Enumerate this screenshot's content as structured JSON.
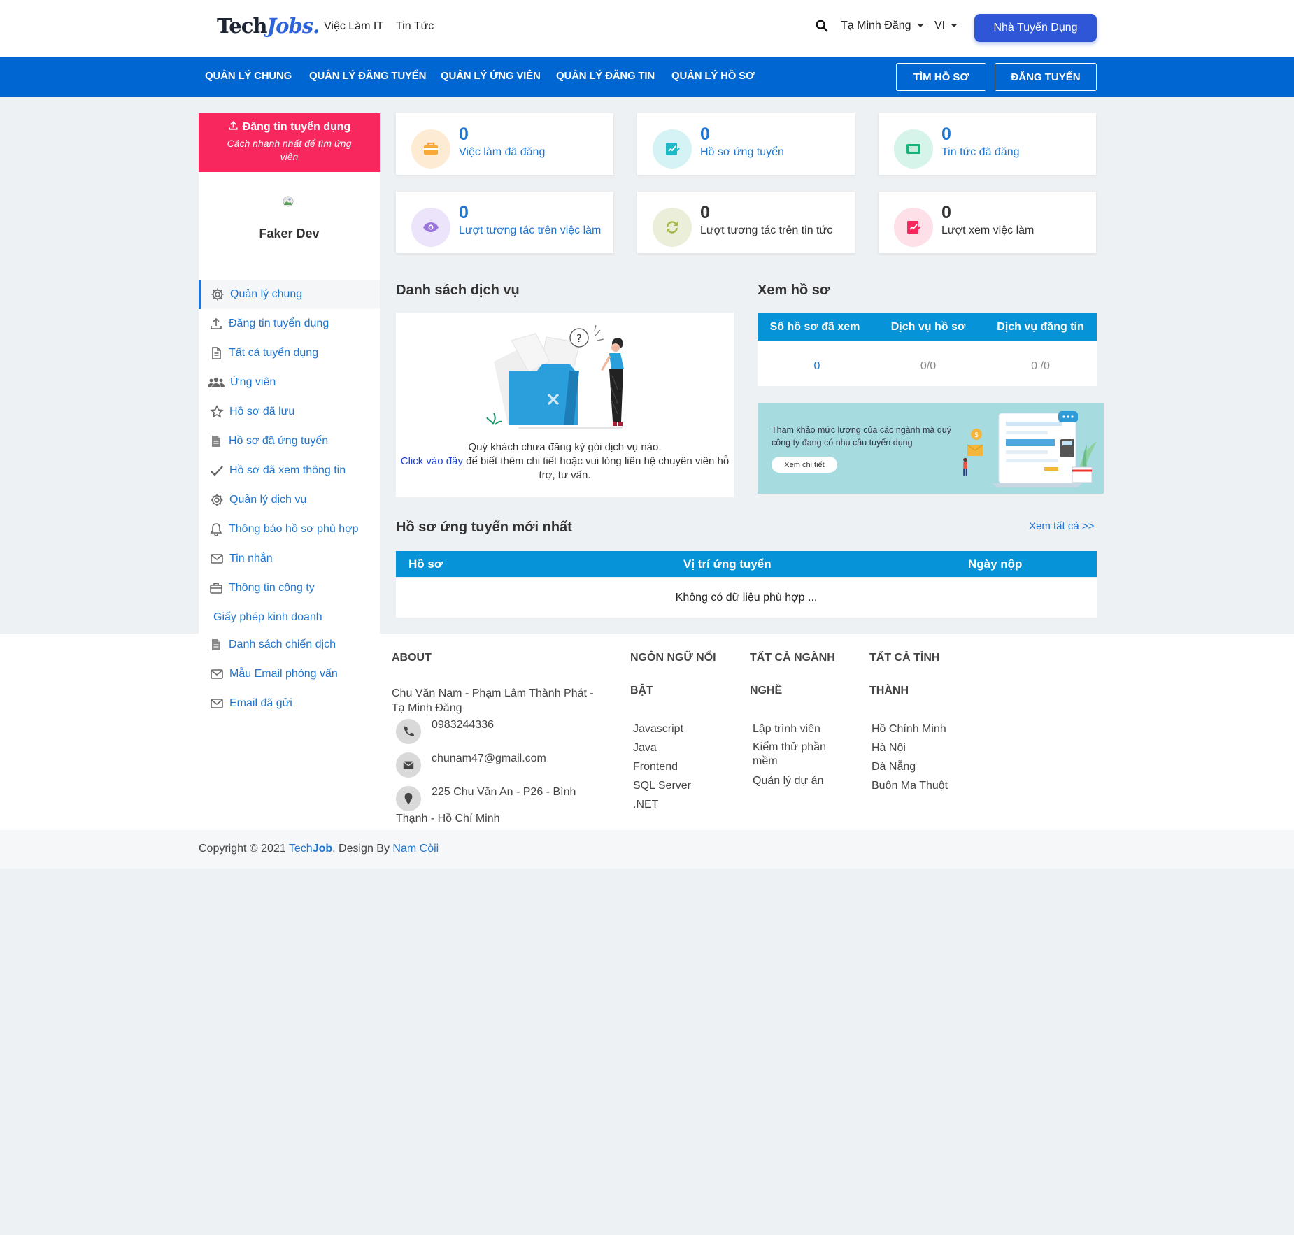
{
  "header": {
    "logo_part1": "Tech",
    "logo_part2": "Jobs.",
    "nav": [
      "Việc Làm IT",
      "Tin Tức"
    ],
    "user": "Tạ Minh Đăng",
    "lang": "VI",
    "employer_button": "Nhà Tuyển Dụng"
  },
  "main_nav": {
    "items": [
      "QUẢN LÝ CHUNG",
      "QUẢN LÝ ĐĂNG TUYỂN",
      "QUẢN LÝ ỨNG VIÊN",
      "QUẢN LÝ ĐĂNG TIN",
      "QUẢN LÝ HỒ SƠ"
    ],
    "btn_find": "TÌM HỒ SƠ",
    "btn_post": "ĐĂNG TUYỂN"
  },
  "sidebar": {
    "post_title": "Đăng tin tuyển dụng",
    "post_subtitle": "Cách nhanh nhất để tìm ứng viên",
    "profile_name": "Faker Dev",
    "menu": [
      {
        "label": "Quản lý chung",
        "icon": "gear-icon"
      },
      {
        "label": "Đăng tin tuyển dụng",
        "icon": "upload-icon"
      },
      {
        "label": "Tất cả tuyển dụng",
        "icon": "document-icon"
      },
      {
        "label": "Ứng viên",
        "icon": "users-icon"
      },
      {
        "label": "Hồ sơ đã lưu",
        "icon": "star-icon"
      },
      {
        "label": "Hồ sơ đã ứng tuyển",
        "icon": "file-icon"
      },
      {
        "label": "Hồ sơ đã xem thông tin",
        "icon": "check-icon"
      },
      {
        "label": "Quản lý dịch vụ",
        "icon": "gear-icon"
      },
      {
        "label": "Thông báo hồ sơ phù hợp",
        "icon": "bell-icon"
      },
      {
        "label": "Tin nhắn",
        "icon": "envelope-icon"
      },
      {
        "label": "Thông tin công ty",
        "icon": "briefcase-icon"
      },
      {
        "label": "Giấy phép kinh doanh",
        "icon": ""
      },
      {
        "label": "Danh sách chiến dịch",
        "icon": "file-icon"
      },
      {
        "label": "Mẫu Email phỏng vấn",
        "icon": "envelope-icon"
      },
      {
        "label": "Email đã gửi",
        "icon": "envelope-icon"
      }
    ]
  },
  "stats": [
    {
      "value": "0",
      "label": "Việc làm đã đăng",
      "icon": "briefcase-icon",
      "bg": "#fdebd3",
      "color": "#f7a93a",
      "text": "#1f75cf"
    },
    {
      "value": "0",
      "label": "Hồ sơ ứng tuyển",
      "icon": "edit-icon",
      "bg": "#d5f3f4",
      "color": "#1fb9c6",
      "text": "#1f75cf"
    },
    {
      "value": "0",
      "label": "Tin tức đã đăng",
      "icon": "news-icon",
      "bg": "#d7f4ea",
      "color": "#17b37a",
      "text": "#1f75cf"
    },
    {
      "value": "0",
      "label": "Lượt tương tác trên việc làm",
      "icon": "eye-icon",
      "bg": "#ebe4fa",
      "color": "#9a74dd",
      "text": "#1f75cf"
    },
    {
      "value": "0",
      "label": "Lượt tương tác trên tin tức",
      "icon": "refresh-icon",
      "bg": "#ebefd9",
      "color": "#a6b84a",
      "text": "#333333"
    },
    {
      "value": "0",
      "label": "Lượt xem việc làm",
      "icon": "edit-icon",
      "bg": "#fde0e8",
      "color": "#f8275e",
      "text": "#333333"
    }
  ],
  "services": {
    "title": "Danh sách dịch vụ",
    "empty_line1": "Quý khách chưa đăng ký gói dịch vụ nào.",
    "link": "Click vào đây",
    "empty_line2": " để biết thêm chi tiết hoặc vui lòng liên hệ chuyên viên hỗ trợ, tư vấn."
  },
  "profiles": {
    "title": "Xem hồ sơ",
    "headers": [
      "Số hồ sơ đã xem",
      "Dịch vụ hồ sơ",
      "Dịch vụ đăng tin"
    ],
    "values": [
      "0",
      "0/0",
      "0 /0"
    ]
  },
  "banner": {
    "text": "Tham khảo mức lương của các ngành mà quý công ty đang có nhu cầu tuyển dụng",
    "button": "Xem chi tiết"
  },
  "applications": {
    "title": "Hồ sơ ứng tuyển mới nhất",
    "view_all": "Xem tất cả >>",
    "headers": [
      "Hồ sơ",
      "Vị trí ứng tuyển",
      "Ngày nộp"
    ],
    "empty": "Không có dữ liệu phù hợp ..."
  },
  "footer": {
    "about_title": "ABOUT",
    "about_text": "Chu Văn Nam - Phạm Lâm Thành Phát - Tạ Minh Đăng",
    "phone": "0983244336",
    "email": "chunam47@gmail.com",
    "address_line1": "225 Chu Văn An - P26 - Bình",
    "address_line2": "Thạnh - Hồ Chí Minh",
    "col2_title_1": "NGÔN NGỮ NỔI",
    "col2_title_2": "BẬT",
    "col2_items": [
      "Javascript",
      "Java",
      "Frontend",
      "SQL Server",
      ".NET"
    ],
    "col3_title_1": "TẤT CẢ NGÀNH",
    "col3_title_2": "NGHỀ",
    "col3_items": [
      "Lập trình viên",
      "Kiểm thử phần mềm",
      "Quản lý dự án"
    ],
    "col4_title_1": "TẤT CẢ TỈNH",
    "col4_title_2": "THÀNH",
    "col4_items": [
      "Hồ Chính Minh",
      "Hà Nội",
      "Đà Nẵng",
      "Buôn Ma Thuột"
    ]
  },
  "copyright": {
    "prefix": "Copyright © 2021 ",
    "brand1": "Tech",
    "brand2": "Job",
    "middle": ". Design By ",
    "author": "Nam Còii"
  }
}
